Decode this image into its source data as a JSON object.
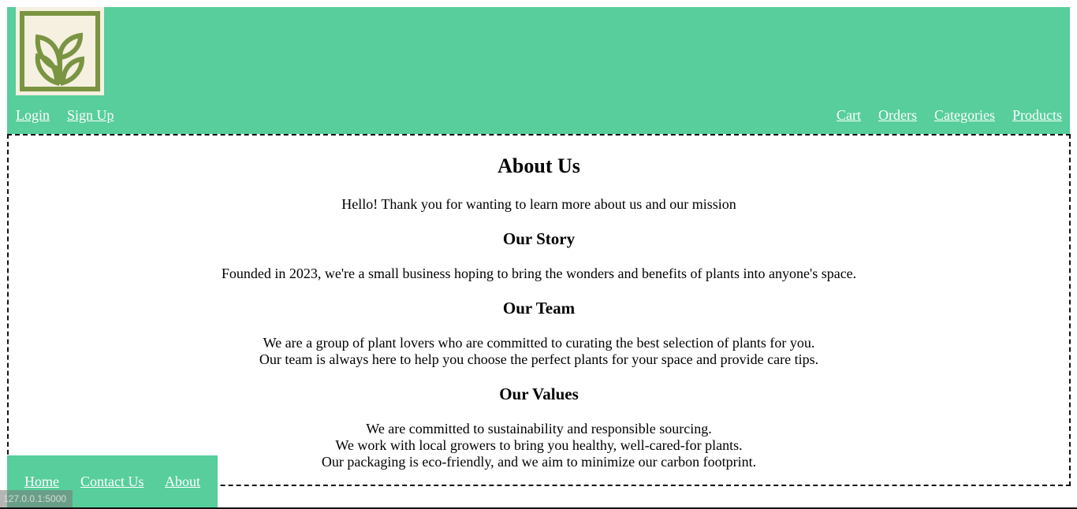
{
  "header": {
    "logo_icon": "leaf-sprout-icon",
    "colors": {
      "background": "#57ce9b",
      "logo_background": "#f5f0df",
      "logo_mark": "#7a9442"
    },
    "left_nav": [
      "Login",
      "Sign Up"
    ],
    "right_nav": [
      "Cart",
      "Orders",
      "Categories",
      "Products"
    ]
  },
  "main": {
    "title": "About Us",
    "intro": "Hello! Thank you for wanting to learn more about us and our mission",
    "sections": [
      {
        "heading": "Our Story",
        "lines": [
          "Founded in 2023, we're a small business hoping to bring the wonders and benefits of plants into anyone's space."
        ]
      },
      {
        "heading": "Our Team",
        "lines": [
          "We are a group of plant lovers who are committed to curating the best selection of plants for you.",
          "Our team is always here to help you choose the perfect plants for your space and provide care tips."
        ]
      },
      {
        "heading": "Our Values",
        "lines": [
          "We are committed to sustainability and responsible sourcing.",
          "We work with local growers to bring you healthy, well-cared-for plants.",
          "Our packaging is eco-friendly, and we aim to minimize our carbon footprint."
        ]
      }
    ]
  },
  "footer": {
    "links": [
      "Home",
      "Contact Us",
      "About"
    ]
  },
  "status_bar": {
    "url": "127.0.0.1:5000"
  }
}
